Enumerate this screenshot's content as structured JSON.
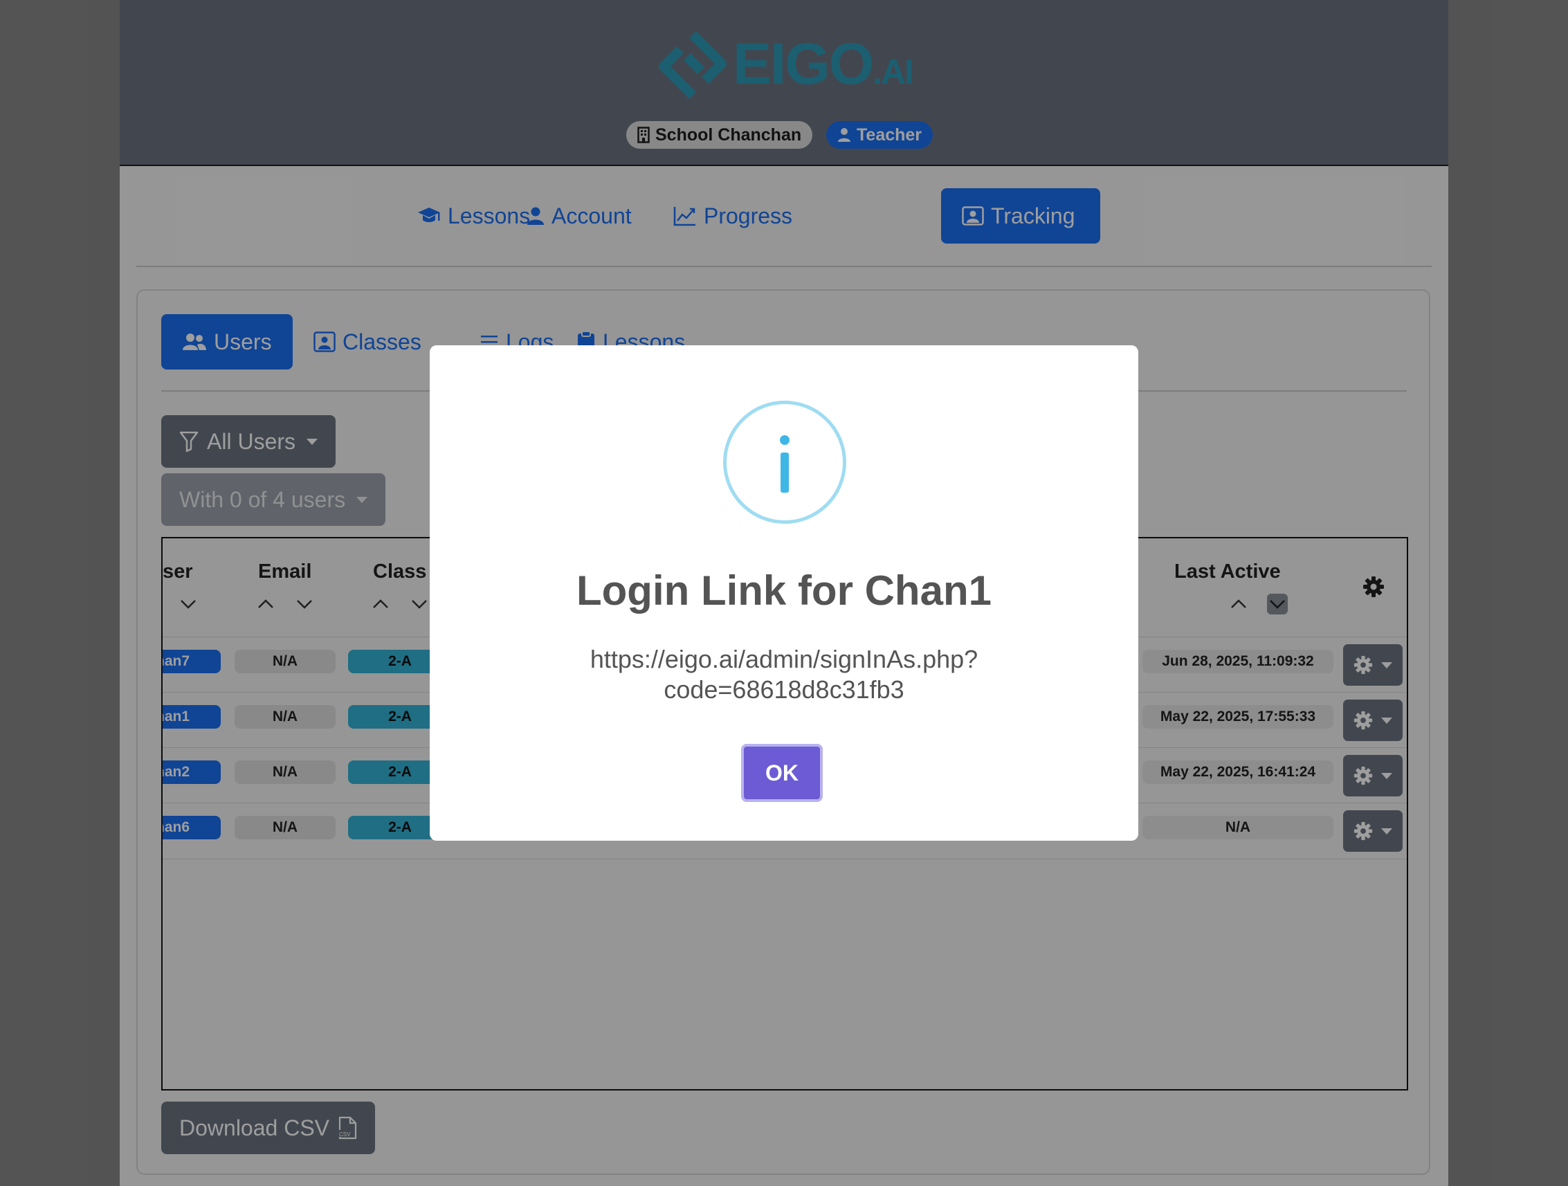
{
  "app": {
    "logo_text": "EIGO",
    "logo_suffix": ".AI",
    "school_label": "School Chanchan",
    "role_label": "Teacher",
    "brand_color": "#2d9ab6",
    "accent_color": "#1a6ff1"
  },
  "topnav": {
    "items": [
      {
        "label": "Lessons",
        "icon": "graduation-cap-icon"
      },
      {
        "label": "Account",
        "icon": "user-icon"
      },
      {
        "label": "Progress",
        "icon": "chart-line-icon"
      },
      {
        "label": "Tracking",
        "icon": "person-badge-icon",
        "active": true
      }
    ]
  },
  "subtabs": {
    "items": [
      {
        "label": "Users",
        "icon": "users-icon",
        "active": true
      },
      {
        "label": "Classes",
        "icon": "person-badge-icon"
      },
      {
        "label": "Logs",
        "icon": "list-icon"
      },
      {
        "label": "Lessons",
        "icon": "clipboard-icon"
      }
    ]
  },
  "filters": {
    "user_filter_label": "All Users",
    "bulk_label": "With 0 of 4 users"
  },
  "table": {
    "headers": {
      "user": "ser",
      "email": "Email",
      "class": "Class",
      "last_active": "Last Active"
    },
    "rows": [
      {
        "user": "han7",
        "email": "N/A",
        "class": "2-A",
        "last_active": "Jun 28, 2025, 11:09:32"
      },
      {
        "user": "han1",
        "email": "N/A",
        "class": "2-A",
        "last_active": "May 22, 2025, 17:55:33"
      },
      {
        "user": "han2",
        "email": "N/A",
        "class": "2-A",
        "last_active": "May 22, 2025, 16:41:24"
      },
      {
        "user": "han6",
        "email": "N/A",
        "class": "2-A",
        "last_active": "N/A"
      }
    ]
  },
  "download_label": "Download CSV",
  "modal": {
    "icon": "info-icon",
    "title": "Login Link for Chan1",
    "text": "https://eigo.ai/admin/signInAs.php?code=68618d8c31fb3",
    "ok_label": "OK"
  }
}
